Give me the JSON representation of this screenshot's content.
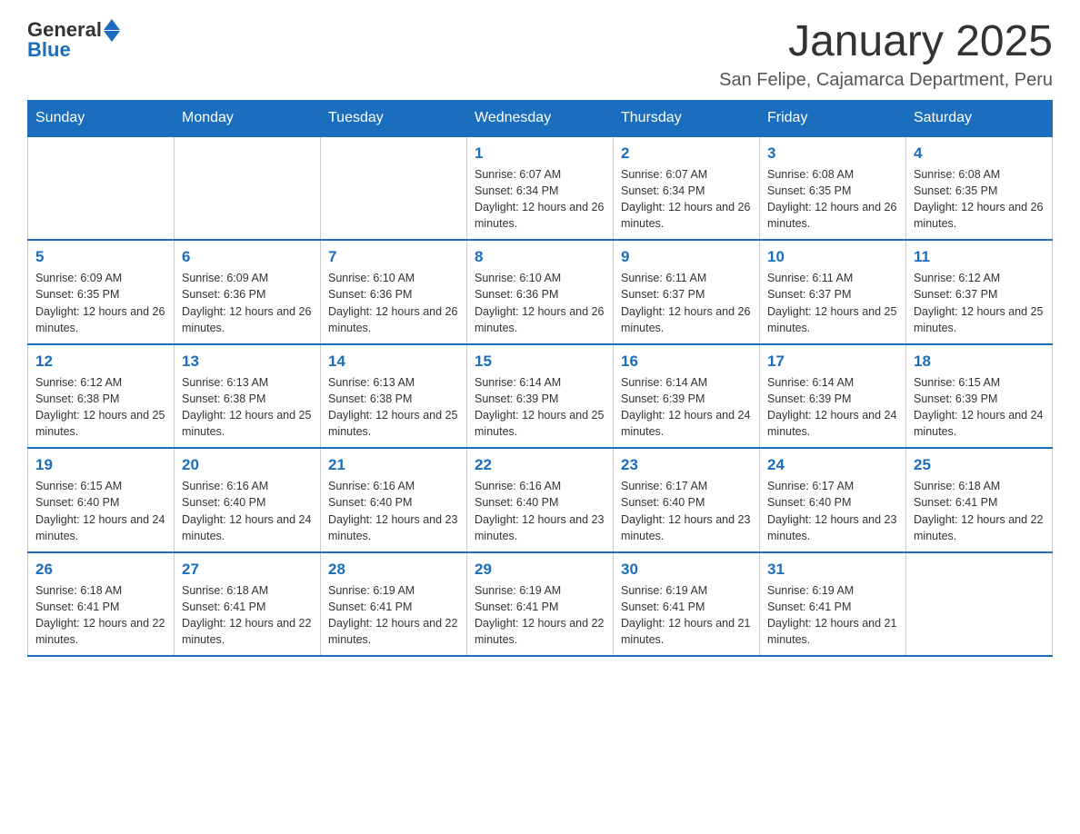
{
  "header": {
    "logo_general": "General",
    "logo_blue": "Blue",
    "month_title": "January 2025",
    "location": "San Felipe, Cajamarca Department, Peru"
  },
  "days_of_week": [
    "Sunday",
    "Monday",
    "Tuesday",
    "Wednesday",
    "Thursday",
    "Friday",
    "Saturday"
  ],
  "weeks": [
    [
      {
        "day": "",
        "info": ""
      },
      {
        "day": "",
        "info": ""
      },
      {
        "day": "",
        "info": ""
      },
      {
        "day": "1",
        "info": "Sunrise: 6:07 AM\nSunset: 6:34 PM\nDaylight: 12 hours and 26 minutes."
      },
      {
        "day": "2",
        "info": "Sunrise: 6:07 AM\nSunset: 6:34 PM\nDaylight: 12 hours and 26 minutes."
      },
      {
        "day": "3",
        "info": "Sunrise: 6:08 AM\nSunset: 6:35 PM\nDaylight: 12 hours and 26 minutes."
      },
      {
        "day": "4",
        "info": "Sunrise: 6:08 AM\nSunset: 6:35 PM\nDaylight: 12 hours and 26 minutes."
      }
    ],
    [
      {
        "day": "5",
        "info": "Sunrise: 6:09 AM\nSunset: 6:35 PM\nDaylight: 12 hours and 26 minutes."
      },
      {
        "day": "6",
        "info": "Sunrise: 6:09 AM\nSunset: 6:36 PM\nDaylight: 12 hours and 26 minutes."
      },
      {
        "day": "7",
        "info": "Sunrise: 6:10 AM\nSunset: 6:36 PM\nDaylight: 12 hours and 26 minutes."
      },
      {
        "day": "8",
        "info": "Sunrise: 6:10 AM\nSunset: 6:36 PM\nDaylight: 12 hours and 26 minutes."
      },
      {
        "day": "9",
        "info": "Sunrise: 6:11 AM\nSunset: 6:37 PM\nDaylight: 12 hours and 26 minutes."
      },
      {
        "day": "10",
        "info": "Sunrise: 6:11 AM\nSunset: 6:37 PM\nDaylight: 12 hours and 25 minutes."
      },
      {
        "day": "11",
        "info": "Sunrise: 6:12 AM\nSunset: 6:37 PM\nDaylight: 12 hours and 25 minutes."
      }
    ],
    [
      {
        "day": "12",
        "info": "Sunrise: 6:12 AM\nSunset: 6:38 PM\nDaylight: 12 hours and 25 minutes."
      },
      {
        "day": "13",
        "info": "Sunrise: 6:13 AM\nSunset: 6:38 PM\nDaylight: 12 hours and 25 minutes."
      },
      {
        "day": "14",
        "info": "Sunrise: 6:13 AM\nSunset: 6:38 PM\nDaylight: 12 hours and 25 minutes."
      },
      {
        "day": "15",
        "info": "Sunrise: 6:14 AM\nSunset: 6:39 PM\nDaylight: 12 hours and 25 minutes."
      },
      {
        "day": "16",
        "info": "Sunrise: 6:14 AM\nSunset: 6:39 PM\nDaylight: 12 hours and 24 minutes."
      },
      {
        "day": "17",
        "info": "Sunrise: 6:14 AM\nSunset: 6:39 PM\nDaylight: 12 hours and 24 minutes."
      },
      {
        "day": "18",
        "info": "Sunrise: 6:15 AM\nSunset: 6:39 PM\nDaylight: 12 hours and 24 minutes."
      }
    ],
    [
      {
        "day": "19",
        "info": "Sunrise: 6:15 AM\nSunset: 6:40 PM\nDaylight: 12 hours and 24 minutes."
      },
      {
        "day": "20",
        "info": "Sunrise: 6:16 AM\nSunset: 6:40 PM\nDaylight: 12 hours and 24 minutes."
      },
      {
        "day": "21",
        "info": "Sunrise: 6:16 AM\nSunset: 6:40 PM\nDaylight: 12 hours and 23 minutes."
      },
      {
        "day": "22",
        "info": "Sunrise: 6:16 AM\nSunset: 6:40 PM\nDaylight: 12 hours and 23 minutes."
      },
      {
        "day": "23",
        "info": "Sunrise: 6:17 AM\nSunset: 6:40 PM\nDaylight: 12 hours and 23 minutes."
      },
      {
        "day": "24",
        "info": "Sunrise: 6:17 AM\nSunset: 6:40 PM\nDaylight: 12 hours and 23 minutes."
      },
      {
        "day": "25",
        "info": "Sunrise: 6:18 AM\nSunset: 6:41 PM\nDaylight: 12 hours and 22 minutes."
      }
    ],
    [
      {
        "day": "26",
        "info": "Sunrise: 6:18 AM\nSunset: 6:41 PM\nDaylight: 12 hours and 22 minutes."
      },
      {
        "day": "27",
        "info": "Sunrise: 6:18 AM\nSunset: 6:41 PM\nDaylight: 12 hours and 22 minutes."
      },
      {
        "day": "28",
        "info": "Sunrise: 6:19 AM\nSunset: 6:41 PM\nDaylight: 12 hours and 22 minutes."
      },
      {
        "day": "29",
        "info": "Sunrise: 6:19 AM\nSunset: 6:41 PM\nDaylight: 12 hours and 22 minutes."
      },
      {
        "day": "30",
        "info": "Sunrise: 6:19 AM\nSunset: 6:41 PM\nDaylight: 12 hours and 21 minutes."
      },
      {
        "day": "31",
        "info": "Sunrise: 6:19 AM\nSunset: 6:41 PM\nDaylight: 12 hours and 21 minutes."
      },
      {
        "day": "",
        "info": ""
      }
    ]
  ]
}
